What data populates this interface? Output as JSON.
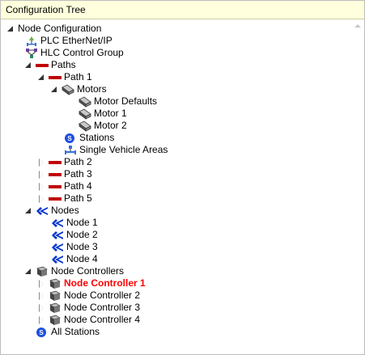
{
  "header": {
    "title": "Configuration Tree"
  },
  "tree": {
    "root": "Node Configuration",
    "plc": "PLC EtherNet/IP",
    "hlc": "HLC Control Group",
    "paths": "Paths",
    "path1": "Path 1",
    "motors": "Motors",
    "motor_defaults": "Motor Defaults",
    "motor1": "Motor 1",
    "motor2": "Motor 2",
    "stations": "Stations",
    "single_vehicle_areas": "Single Vehicle Areas",
    "path2": "Path 2",
    "path3": "Path 3",
    "path4": "Path 4",
    "path5": "Path 5",
    "nodes": "Nodes",
    "node1": "Node 1",
    "node2": "Node 2",
    "node3": "Node 3",
    "node4": "Node 4",
    "node_controllers": "Node Controllers",
    "nc1": "Node Controller 1",
    "nc2": "Node Controller 2",
    "nc3": "Node Controller 3",
    "nc4": "Node Controller 4",
    "all_stations": "All Stations"
  },
  "colors": {
    "selected": "#ff0000",
    "path": "#c00000",
    "node": "#0033cc",
    "header_bg": "#ffffdd"
  }
}
